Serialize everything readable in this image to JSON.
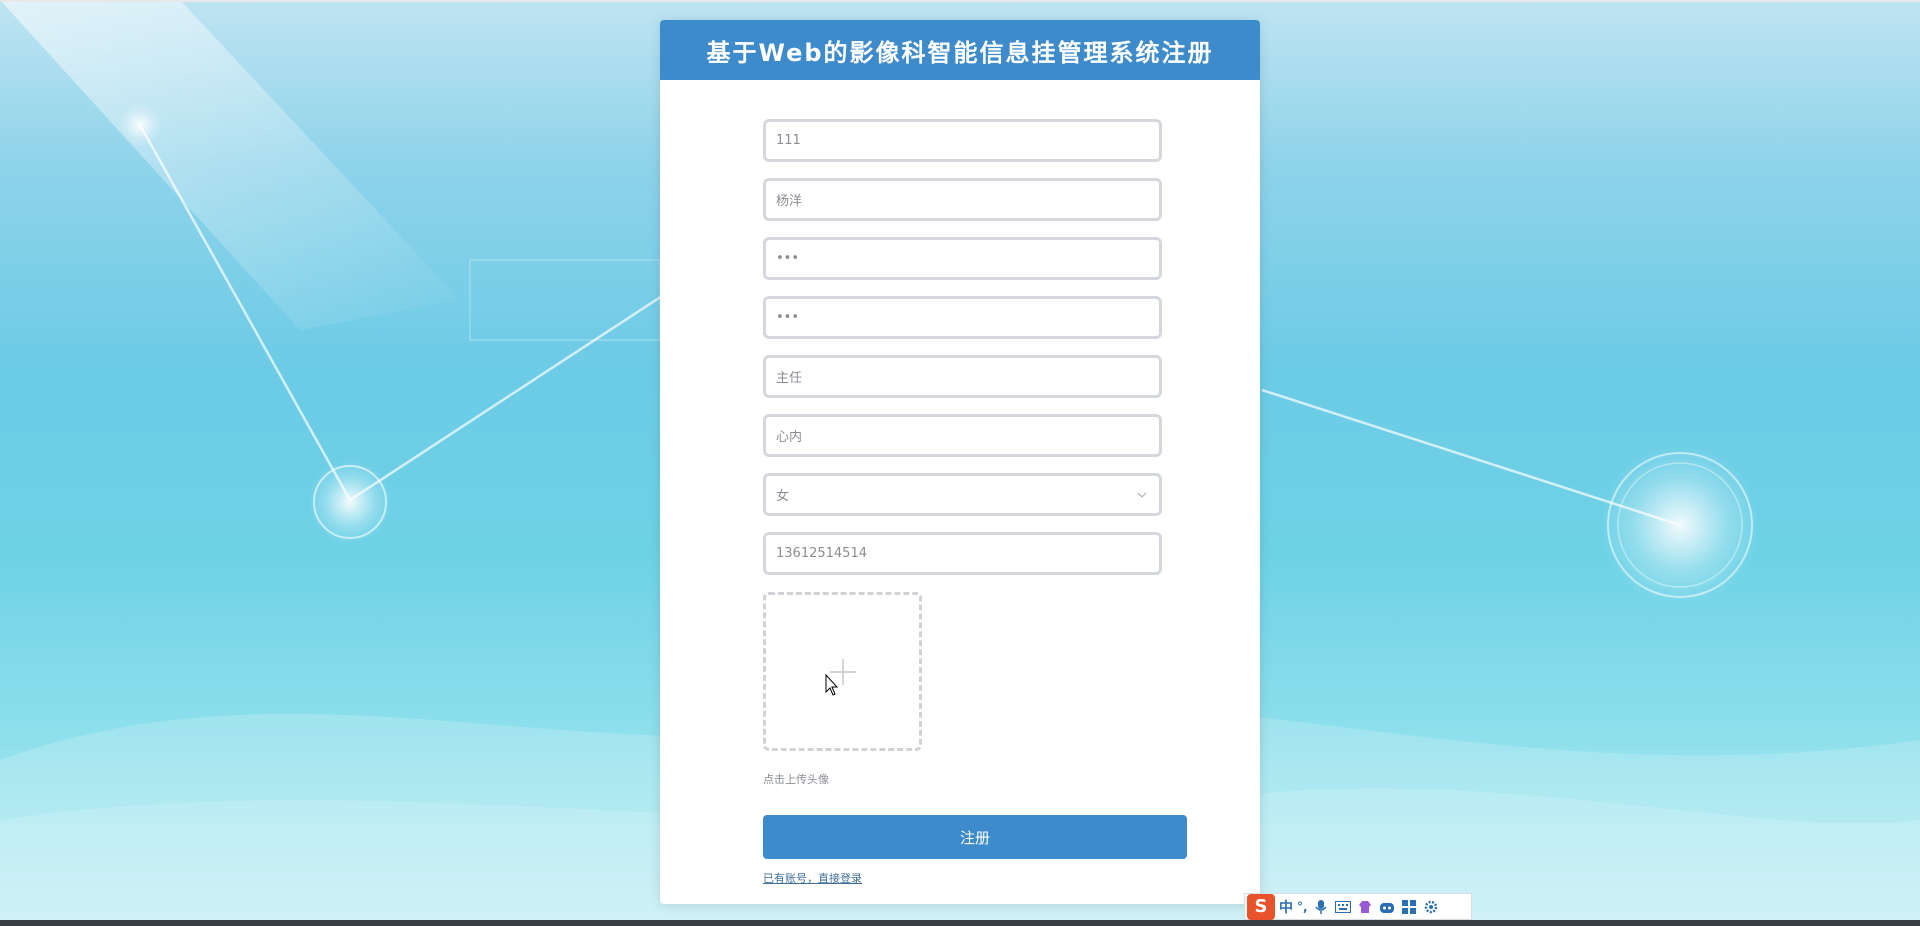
{
  "form": {
    "title": "基于Web的影像科智能信息挂管理系统注册",
    "fields": [
      {
        "name": "username",
        "value": "111"
      },
      {
        "name": "real-name",
        "value": "杨洋"
      },
      {
        "name": "password",
        "value": "•••"
      },
      {
        "name": "confirm-password",
        "value": "•••"
      },
      {
        "name": "position",
        "value": "主任"
      },
      {
        "name": "department",
        "value": "心内"
      },
      {
        "name": "gender",
        "value": "女"
      },
      {
        "name": "phone",
        "value": "13612514514"
      }
    ],
    "upload_tip": "点击上传头像",
    "submit_label": "注册",
    "login_link": "已有账号，直接登录"
  },
  "ime": {
    "logo": "S",
    "mode": "中",
    "punct": "°,",
    "icons": [
      "microphone-icon",
      "keyboard-icon",
      "skin-icon",
      "robot-icon",
      "grid-icon",
      "settings-icon"
    ]
  },
  "colors": {
    "accent": "#3d8bcb",
    "ime_logo": "#e8532b"
  }
}
